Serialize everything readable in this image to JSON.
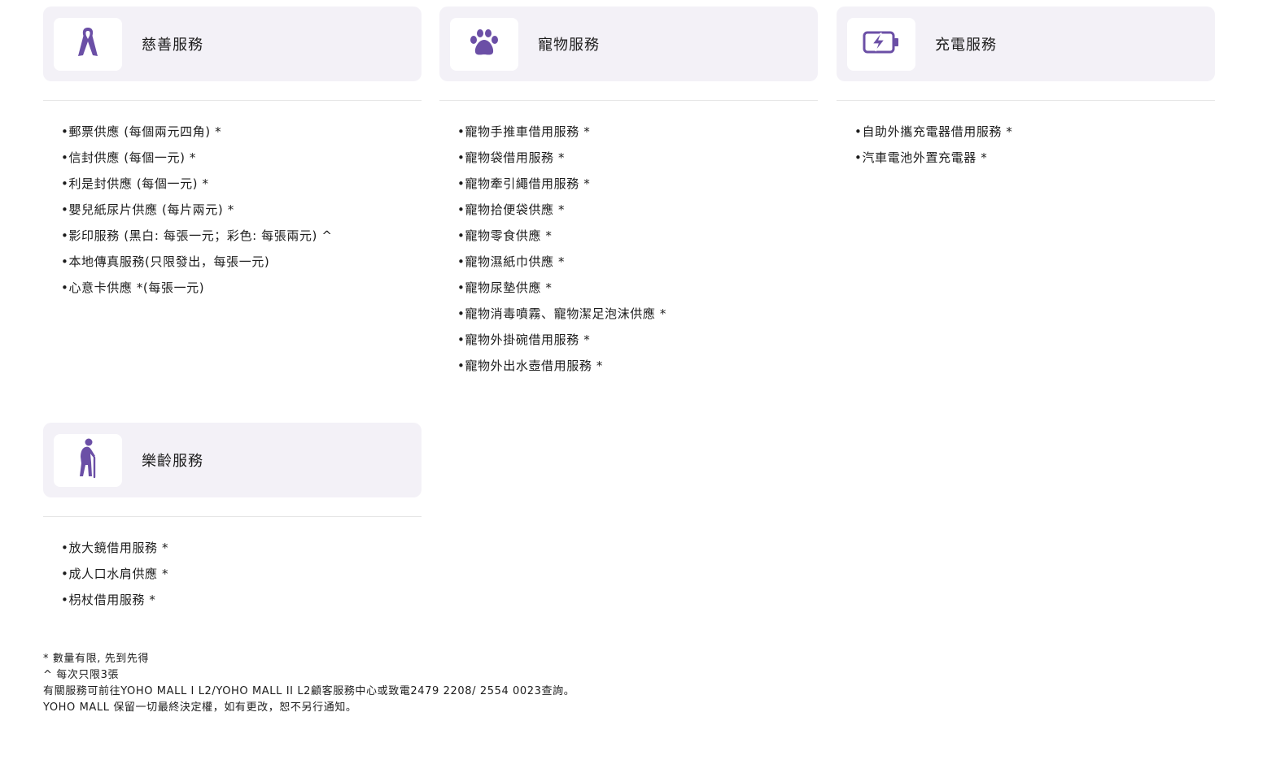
{
  "accent_color": "#6b4fa6",
  "cards": [
    {
      "title": "慈善服務",
      "icon": "ribbon-icon",
      "items": [
        "郵票供應 (每個兩元四角) *",
        "信封供應 (每個一元) *",
        "利是封供應 (每個一元) *",
        "嬰兒紙尿片供應 (每片兩元) *",
        "影印服務 (黑白: 每張一元；彩色: 每張兩元) ^",
        "本地傳真服務(只限發出，每張一元)",
        "心意卡供應 *(每張一元)"
      ]
    },
    {
      "title": "寵物服務",
      "icon": "paw-icon",
      "items": [
        "寵物手推車借用服務 *",
        "寵物袋借用服務 *",
        "寵物牽引繩借用服務 *",
        "寵物拾便袋供應 *",
        "寵物零食供應 *",
        "寵物濕紙巾供應 *",
        "寵物尿墊供應 *",
        "寵物消毒噴霧、寵物潔足泡沫供應 *",
        "寵物外掛碗借用服務 *",
        "寵物外出水壺借用服務 *"
      ]
    },
    {
      "title": "充電服務",
      "icon": "battery-charging-icon",
      "items": [
        "自助外攜充電器借用服務 *",
        "汽車電池外置充電器 *"
      ]
    },
    {
      "title": "樂齡服務",
      "icon": "elderly-person-icon",
      "items": [
        "放大鏡借用服務 *",
        "成人口水肩供應 *",
        "枴杖借用服務 *"
      ]
    }
  ],
  "footnotes": [
    "* 數量有限, 先到先得",
    "^ 每次只限3張",
    "有關服務可前往YOHO MALL I L2/YOHO MALL II L2顧客服務中心或致電2479 2208/ 2554 0023查詢。",
    "YOHO MALL 保留一切最終決定權，如有更改，恕不另行通知。"
  ]
}
